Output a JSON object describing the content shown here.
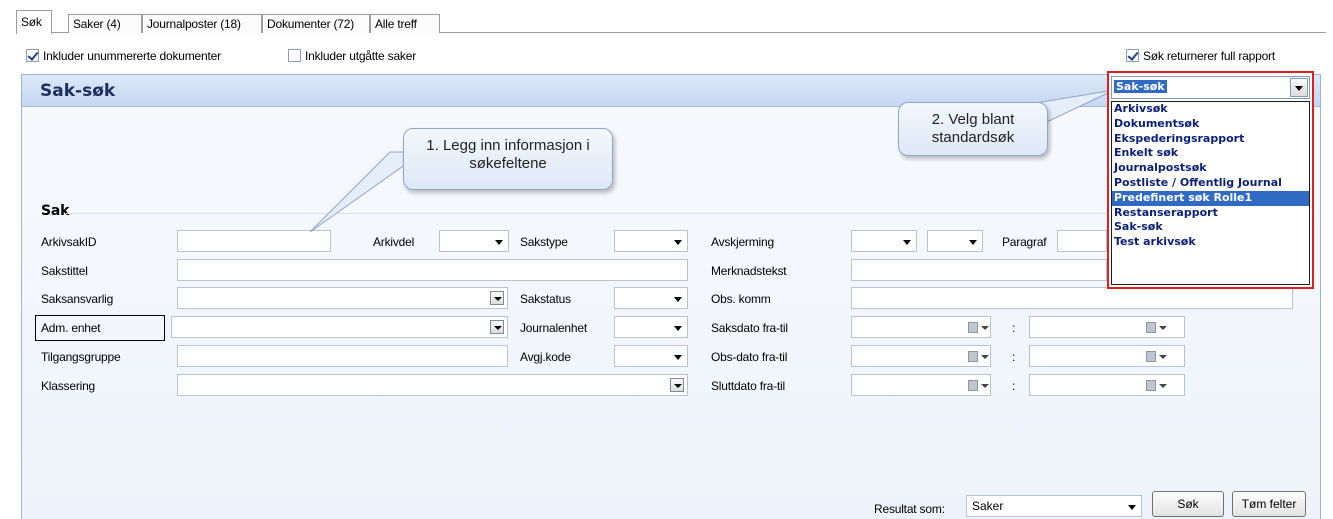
{
  "tabs": [
    {
      "label": "Søk"
    },
    {
      "label": "Saker (4)"
    },
    {
      "label": "Journalposter (18)"
    },
    {
      "label": "Dokumenter (72)"
    },
    {
      "label": "Alle treff"
    }
  ],
  "options": {
    "include_unnumbered": "Inkluder unummererte dokumenter",
    "include_expired": "Inkluder utgåtte saker",
    "full_report": "Søk returnerer full rapport"
  },
  "panel": {
    "title": "Sak-søk",
    "section": "Sak"
  },
  "labels": {
    "arkivsakid": "ArkivsakID",
    "arkivdel": "Arkivdel",
    "sakstype": "Sakstype",
    "avskjerming": "Avskjerming",
    "paragraf": "Paragraf",
    "sakstittel": "Sakstittel",
    "merknadstekst": "Merknadstekst",
    "saksansvarlig": "Saksansvarlig",
    "sakstatus": "Sakstatus",
    "obs_komm": "Obs. komm",
    "adm_enhet": "Adm. enhet",
    "journalenhet": "Journalenhet",
    "saksdato": "Saksdato fra-til",
    "tilgangsgruppe": "Tilgangsgruppe",
    "avgj_kode": "Avgj.kode",
    "obs_dato": "Obs-dato fra-til",
    "klassering": "Klassering",
    "sluttdato": "Sluttdato fra-til",
    "colon": ":"
  },
  "callouts": {
    "one": "1. Legg inn informasjon i søkefeltene",
    "two": "2. Velg blant standardsøk"
  },
  "search_type": {
    "selected": "Sak-søk",
    "items": [
      "Arkivsøk",
      "Dokumentsøk",
      "Ekspederingsrapport",
      "Enkelt søk",
      "Journalpostsøk",
      "Postliste / Offentlig Journal",
      "Predefinert søk Rolle1",
      "Restanserapport",
      "Sak-søk",
      "Test arkivsøk"
    ],
    "highlighted_index": 6
  },
  "footer": {
    "result_label": "Resultat som:",
    "result_value": "Saker",
    "search_button": "Søk",
    "clear_button": "Tøm felter"
  },
  "colors": {
    "accent": "#316ac5",
    "highlight_border": "#e0201f",
    "title": "#1c2f5f"
  }
}
